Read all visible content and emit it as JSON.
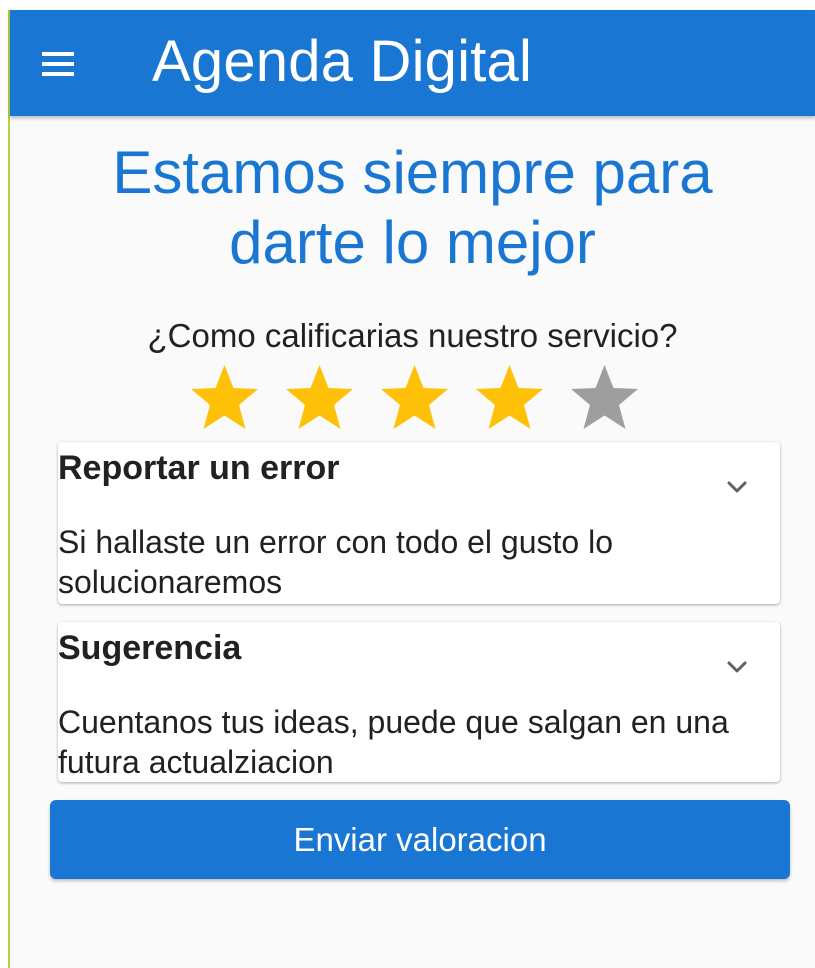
{
  "app_bar": {
    "title": "Agenda Digital",
    "menu_icon": "hamburger-menu-icon",
    "background_color": "#1976d2"
  },
  "headline": {
    "line1": "Estamos siempre para",
    "line2": "darte lo mejor",
    "color": "#1976d2"
  },
  "rating": {
    "question": "¿Como calificarias nuestro servicio?",
    "max_stars": 5,
    "value": 4,
    "filled_color": "#ffc107",
    "empty_color": "#9e9e9e",
    "star_icon": "star-icon"
  },
  "cards": [
    {
      "title": "Reportar un error",
      "description": "Si hallaste un error con todo el gusto lo solucionaremos",
      "icon": "chevron-down-icon"
    },
    {
      "title": "Sugerencia",
      "description": "Cuentanos tus ideas, puede que salgan en una futura actualziacion",
      "icon": "chevron-down-icon"
    }
  ],
  "submit": {
    "label": "Enviar valoracion",
    "color": "#1976d2"
  }
}
